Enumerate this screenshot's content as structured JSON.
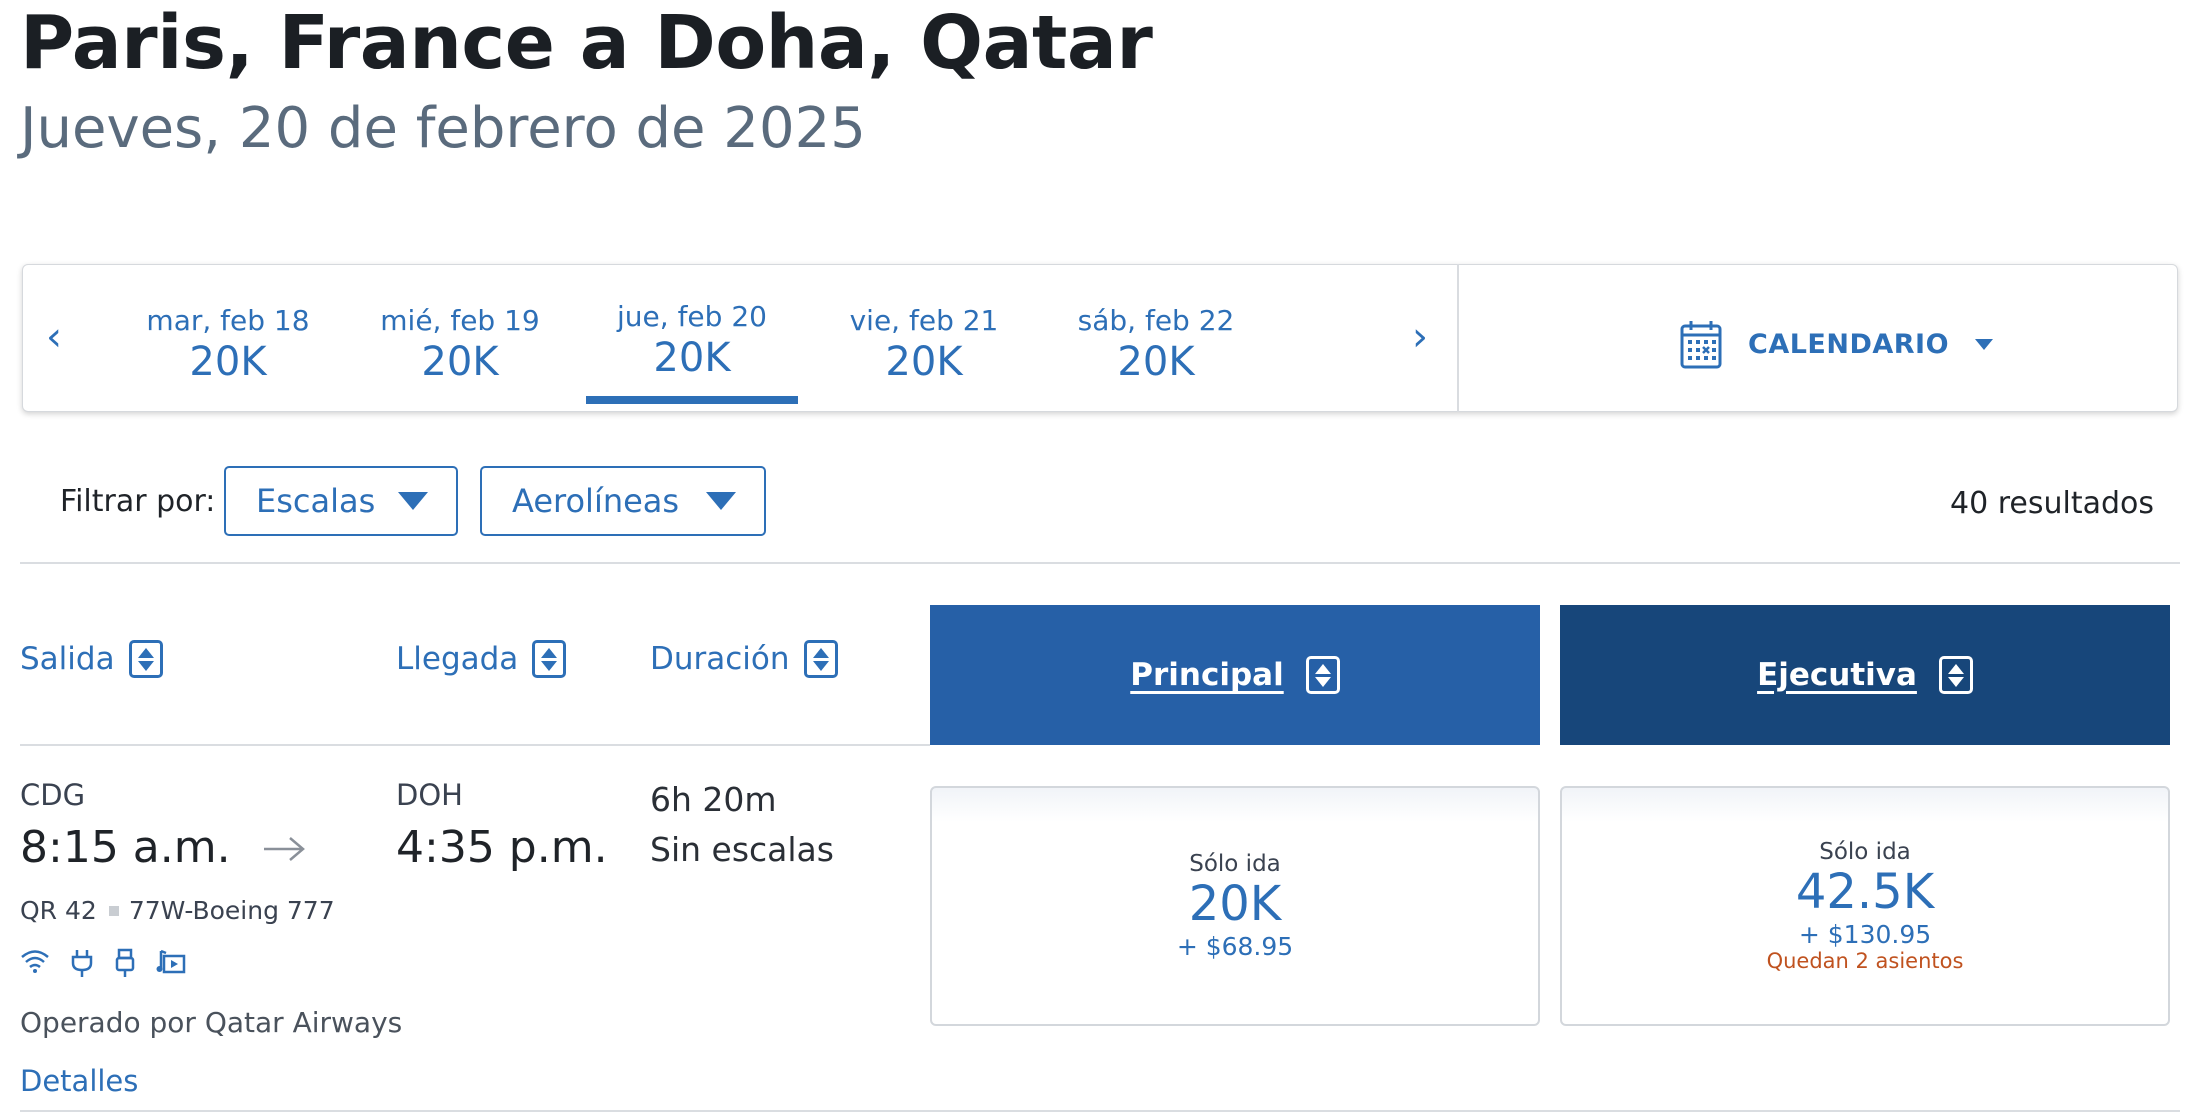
{
  "header": {
    "title": "Paris, France a Doha, Qatar",
    "subtitle": "Jueves, 20 de febrero de 2025"
  },
  "date_nav": {
    "prev_symbol": "‹",
    "next_symbol": "›",
    "dates": [
      {
        "day": "mar, feb 18",
        "price": "20K"
      },
      {
        "day": "mié, feb 19",
        "price": "20K"
      },
      {
        "day": "jue, feb 20",
        "price": "20K",
        "selected": true
      },
      {
        "day": "vie, feb 21",
        "price": "20K"
      },
      {
        "day": "sáb, feb 22",
        "price": "20K"
      }
    ],
    "calendar_label": "CALENDARIO",
    "calendar_icon": "calendar-icon"
  },
  "filters": {
    "label": "Filtrar por:",
    "stops": "Escalas",
    "airlines": "Aerolíneas",
    "results": "40 resultados"
  },
  "columns": {
    "departure": "Salida",
    "arrival": "Llegada",
    "duration": "Duración",
    "main": "Principal",
    "business": "Ejecutiva"
  },
  "flight": {
    "origin": "CDG",
    "depart_time": "8:15 a.m.",
    "destination": "DOH",
    "arrive_time": "4:35 p.m.",
    "duration": "6h 20m",
    "stops": "Sin escalas",
    "flight_number": "QR 42",
    "aircraft": "77W-Boeing 777",
    "amenities": [
      "wifi-icon",
      "power-outlet-icon",
      "usb-icon",
      "entertainment-icon"
    ],
    "operated_by": "Operado por Qatar Airways",
    "details_link": "Detalles",
    "fares": {
      "main": {
        "type": "Sólo ida",
        "miles": "20K",
        "fee": "+ $68.95"
      },
      "business": {
        "type": "Sólo ida",
        "miles": "42.5K",
        "fee": "+ $130.95",
        "seats_left": "Quedan 2 asientos"
      }
    }
  },
  "colors": {
    "accent_blue": "#2d6fb7",
    "main_header": "#2660a7",
    "business_header": "#17467a",
    "warning": "#c0521f"
  }
}
